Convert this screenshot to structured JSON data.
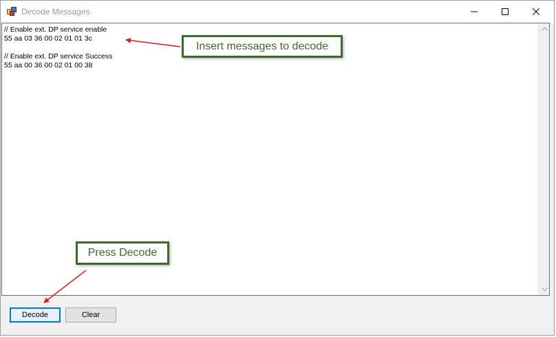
{
  "window": {
    "title": "Decode Messages",
    "icon": "app-window-icon",
    "controls": [
      "minimize-icon",
      "maximize-icon",
      "close-icon"
    ]
  },
  "editor": {
    "lines": [
      "// Enable ext. DP service enable",
      "55 aa 03 36 00 02 01 01 3c",
      "",
      "// Enable ext. DP service Success",
      "55 aa 00 36 00 02 01 00 38"
    ],
    "text": "// Enable ext. DP service enable\n55 aa 03 36 00 02 01 01 3c\n\n// Enable ext. DP service Success\n55 aa 00 36 00 02 01 00 38"
  },
  "buttons": {
    "decode_label": "Decode",
    "clear_label": "Clear"
  },
  "annotations": {
    "insert_callout": "Insert messages to decode",
    "press_callout": "Press Decode",
    "callout_border_color": "#3b6a2a",
    "arrow_color": "#e02020"
  },
  "colors": {
    "focus_border": "#0078d7",
    "window_bg": "#f0f0f0"
  }
}
